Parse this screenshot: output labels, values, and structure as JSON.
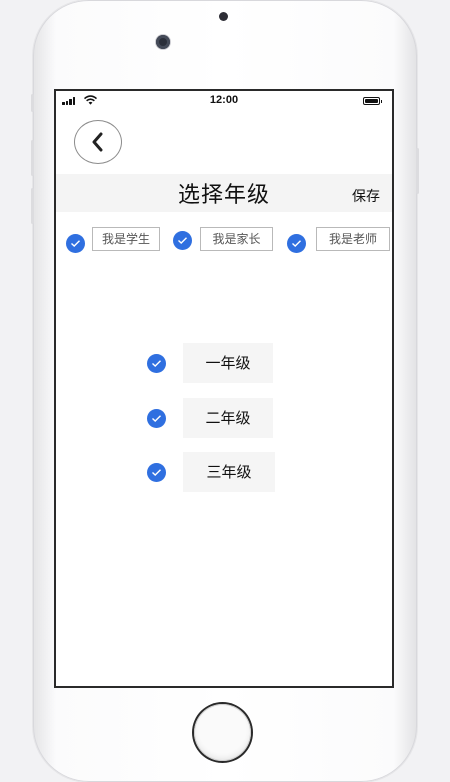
{
  "status_bar": {
    "time": "12:00"
  },
  "header": {
    "title": "选择年级",
    "save_label": "保存"
  },
  "roles": [
    {
      "label": "我是学生",
      "checked": true
    },
    {
      "label": "我是家长",
      "checked": true
    },
    {
      "label": "我是老师",
      "checked": true
    }
  ],
  "grades": [
    {
      "label": "一年级",
      "checked": true
    },
    {
      "label": "二年级",
      "checked": true
    },
    {
      "label": "三年级",
      "checked": true
    }
  ],
  "colors": {
    "accent": "#2f6fe0",
    "header_bg": "#f4f4f4",
    "grade_bg": "#f5f5f5"
  },
  "icons": {
    "back": "chevron-left-icon",
    "check": "check-icon"
  }
}
